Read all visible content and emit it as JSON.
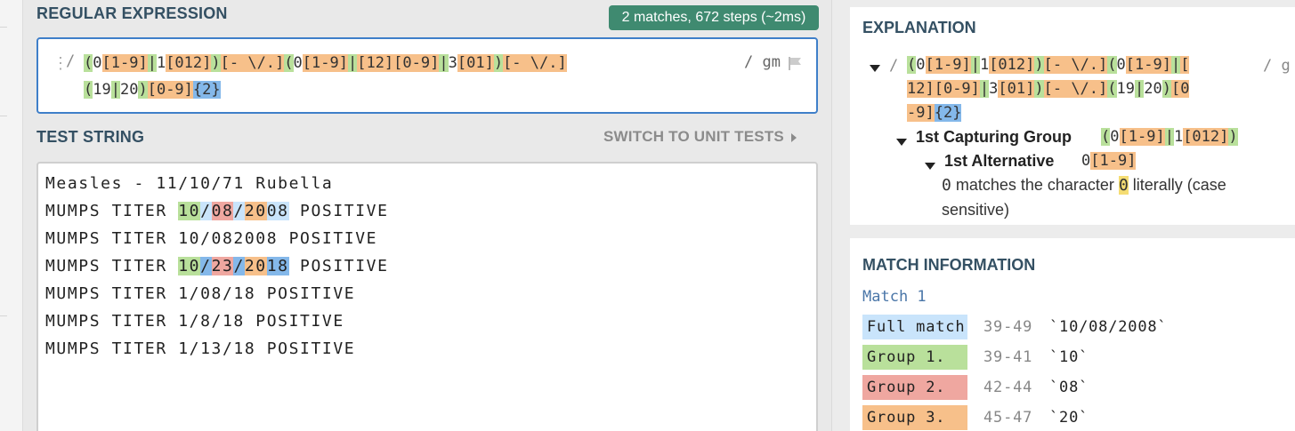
{
  "regex_section": {
    "title": "REGULAR EXPRESSION",
    "badge": "2 matches, 672 steps (~2ms)",
    "delimiter_open": "/",
    "delimiter_close": "/",
    "flags": "gm",
    "line1_tokens": [
      {
        "t": "(",
        "c": "g"
      },
      {
        "t": "0",
        "c": ""
      },
      {
        "t": "[1-9]",
        "c": "o"
      },
      {
        "t": "|",
        "c": "g"
      },
      {
        "t": "1",
        "c": ""
      },
      {
        "t": "[012]",
        "c": "o"
      },
      {
        "t": ")",
        "c": "g"
      },
      {
        "t": "[- \\/.]",
        "c": "o"
      },
      {
        "t": "(",
        "c": "g"
      },
      {
        "t": "0",
        "c": ""
      },
      {
        "t": "[1-9]",
        "c": "o"
      },
      {
        "t": "|",
        "c": "g"
      },
      {
        "t": "[12]",
        "c": "o"
      },
      {
        "t": "[0-9]",
        "c": "o"
      },
      {
        "t": "|",
        "c": "g"
      },
      {
        "t": "3",
        "c": ""
      },
      {
        "t": "[01]",
        "c": "o"
      },
      {
        "t": ")",
        "c": "g"
      },
      {
        "t": "[- \\/.]",
        "c": "o"
      }
    ],
    "line2_tokens": [
      {
        "t": "(",
        "c": "g"
      },
      {
        "t": "19",
        "c": ""
      },
      {
        "t": "|",
        "c": "g"
      },
      {
        "t": "20",
        "c": ""
      },
      {
        "t": ")",
        "c": "g"
      },
      {
        "t": "[0-9]",
        "c": "o"
      },
      {
        "t": "{2}",
        "c": "b"
      }
    ]
  },
  "test_section": {
    "title": "TEST STRING",
    "switch_label": "SWITCH TO UNIT TESTS",
    "lines": [
      [
        {
          "t": "Measles - 11/10/71 Rubella",
          "c": ""
        }
      ],
      [
        {
          "t": "MUMPS TITER ",
          "c": ""
        },
        {
          "t": "10",
          "c": "m-g"
        },
        {
          "t": "/",
          "c": "m-lt"
        },
        {
          "t": "08",
          "c": "m-r"
        },
        {
          "t": "/",
          "c": "m-lt"
        },
        {
          "t": "20",
          "c": "m-o"
        },
        {
          "t": "08",
          "c": "m-lt"
        },
        {
          "t": " POSITIVE",
          "c": ""
        }
      ],
      [
        {
          "t": "MUMPS TITER 10/082008 POSITIVE",
          "c": ""
        }
      ],
      [
        {
          "t": "MUMPS TITER ",
          "c": ""
        },
        {
          "t": "10",
          "c": "m-g"
        },
        {
          "t": "/",
          "c": "m-b"
        },
        {
          "t": "23",
          "c": "m-r"
        },
        {
          "t": "/",
          "c": "m-b"
        },
        {
          "t": "20",
          "c": "m-o"
        },
        {
          "t": "18",
          "c": "m-b"
        },
        {
          "t": " POSITIVE",
          "c": ""
        }
      ],
      [
        {
          "t": "MUMPS TITER 1/08/18 POSITIVE",
          "c": ""
        }
      ],
      [
        {
          "t": "MUMPS TITER 1/8/18 POSITIVE",
          "c": ""
        }
      ],
      [
        {
          "t": "MUMPS TITER 1/13/18 POSITIVE",
          "c": ""
        }
      ]
    ]
  },
  "explanation": {
    "title": "EXPLANATION",
    "slash": "/",
    "g_char": "/ g",
    "lines": [
      [
        {
          "t": "(",
          "c": "g"
        },
        {
          "t": "0",
          "c": ""
        },
        {
          "t": "[1-9]",
          "c": "o"
        },
        {
          "t": "|",
          "c": "g"
        },
        {
          "t": "1",
          "c": ""
        },
        {
          "t": "[012]",
          "c": "o"
        },
        {
          "t": ")",
          "c": "g"
        },
        {
          "t": "[- \\/.]",
          "c": "o"
        },
        {
          "t": "(",
          "c": "g"
        },
        {
          "t": "0",
          "c": ""
        },
        {
          "t": "[1-9]",
          "c": "o"
        },
        {
          "t": "|",
          "c": "g"
        },
        {
          "t": "[",
          "c": "o"
        }
      ],
      [
        {
          "t": "12]",
          "c": "o"
        },
        {
          "t": "[0-9]",
          "c": "o"
        },
        {
          "t": "|",
          "c": "g"
        },
        {
          "t": "3",
          "c": ""
        },
        {
          "t": "[01]",
          "c": "o"
        },
        {
          "t": ")",
          "c": "g"
        },
        {
          "t": "[- \\/.]",
          "c": "o"
        },
        {
          "t": "(",
          "c": "g"
        },
        {
          "t": "19",
          "c": ""
        },
        {
          "t": "|",
          "c": "g"
        },
        {
          "t": "20",
          "c": ""
        },
        {
          "t": ")",
          "c": "g"
        },
        {
          "t": "[0",
          "c": "o"
        }
      ],
      [
        {
          "t": "-9]",
          "c": "o"
        },
        {
          "t": "{2}",
          "c": "b"
        }
      ]
    ],
    "group1_label": "1st Capturing Group",
    "group1_tokens": [
      {
        "t": "(",
        "c": "g"
      },
      {
        "t": "0",
        "c": ""
      },
      {
        "t": "[1-9]",
        "c": "o"
      },
      {
        "t": "|",
        "c": "g"
      },
      {
        "t": "1",
        "c": ""
      },
      {
        "t": "[012]",
        "c": "o"
      },
      {
        "t": ")",
        "c": "g"
      }
    ],
    "alt1_label": "1st Alternative",
    "alt1_tokens": [
      {
        "t": "0",
        "c": ""
      },
      {
        "t": "[1-9]",
        "c": "o"
      }
    ],
    "desc_char": "0",
    "desc_mid": " matches the character ",
    "desc_hl": "0",
    "desc_end": " literally (case",
    "desc_cut": "sensitive)"
  },
  "match_info": {
    "title": "MATCH INFORMATION",
    "match_label": "Match 1",
    "rows": [
      {
        "label": "Full match",
        "range": "39-49",
        "value": "`10/08/2008`",
        "color": "#c9e4fb"
      },
      {
        "label": "Group 1.",
        "range": "39-41",
        "value": "`10`",
        "color": "#b9e09b"
      },
      {
        "label": "Group 2.",
        "range": "42-44",
        "value": "`08`",
        "color": "#efa7a0"
      },
      {
        "label": "Group 3.",
        "range": "45-47",
        "value": "`20`",
        "color": "#f7c08a"
      }
    ]
  }
}
